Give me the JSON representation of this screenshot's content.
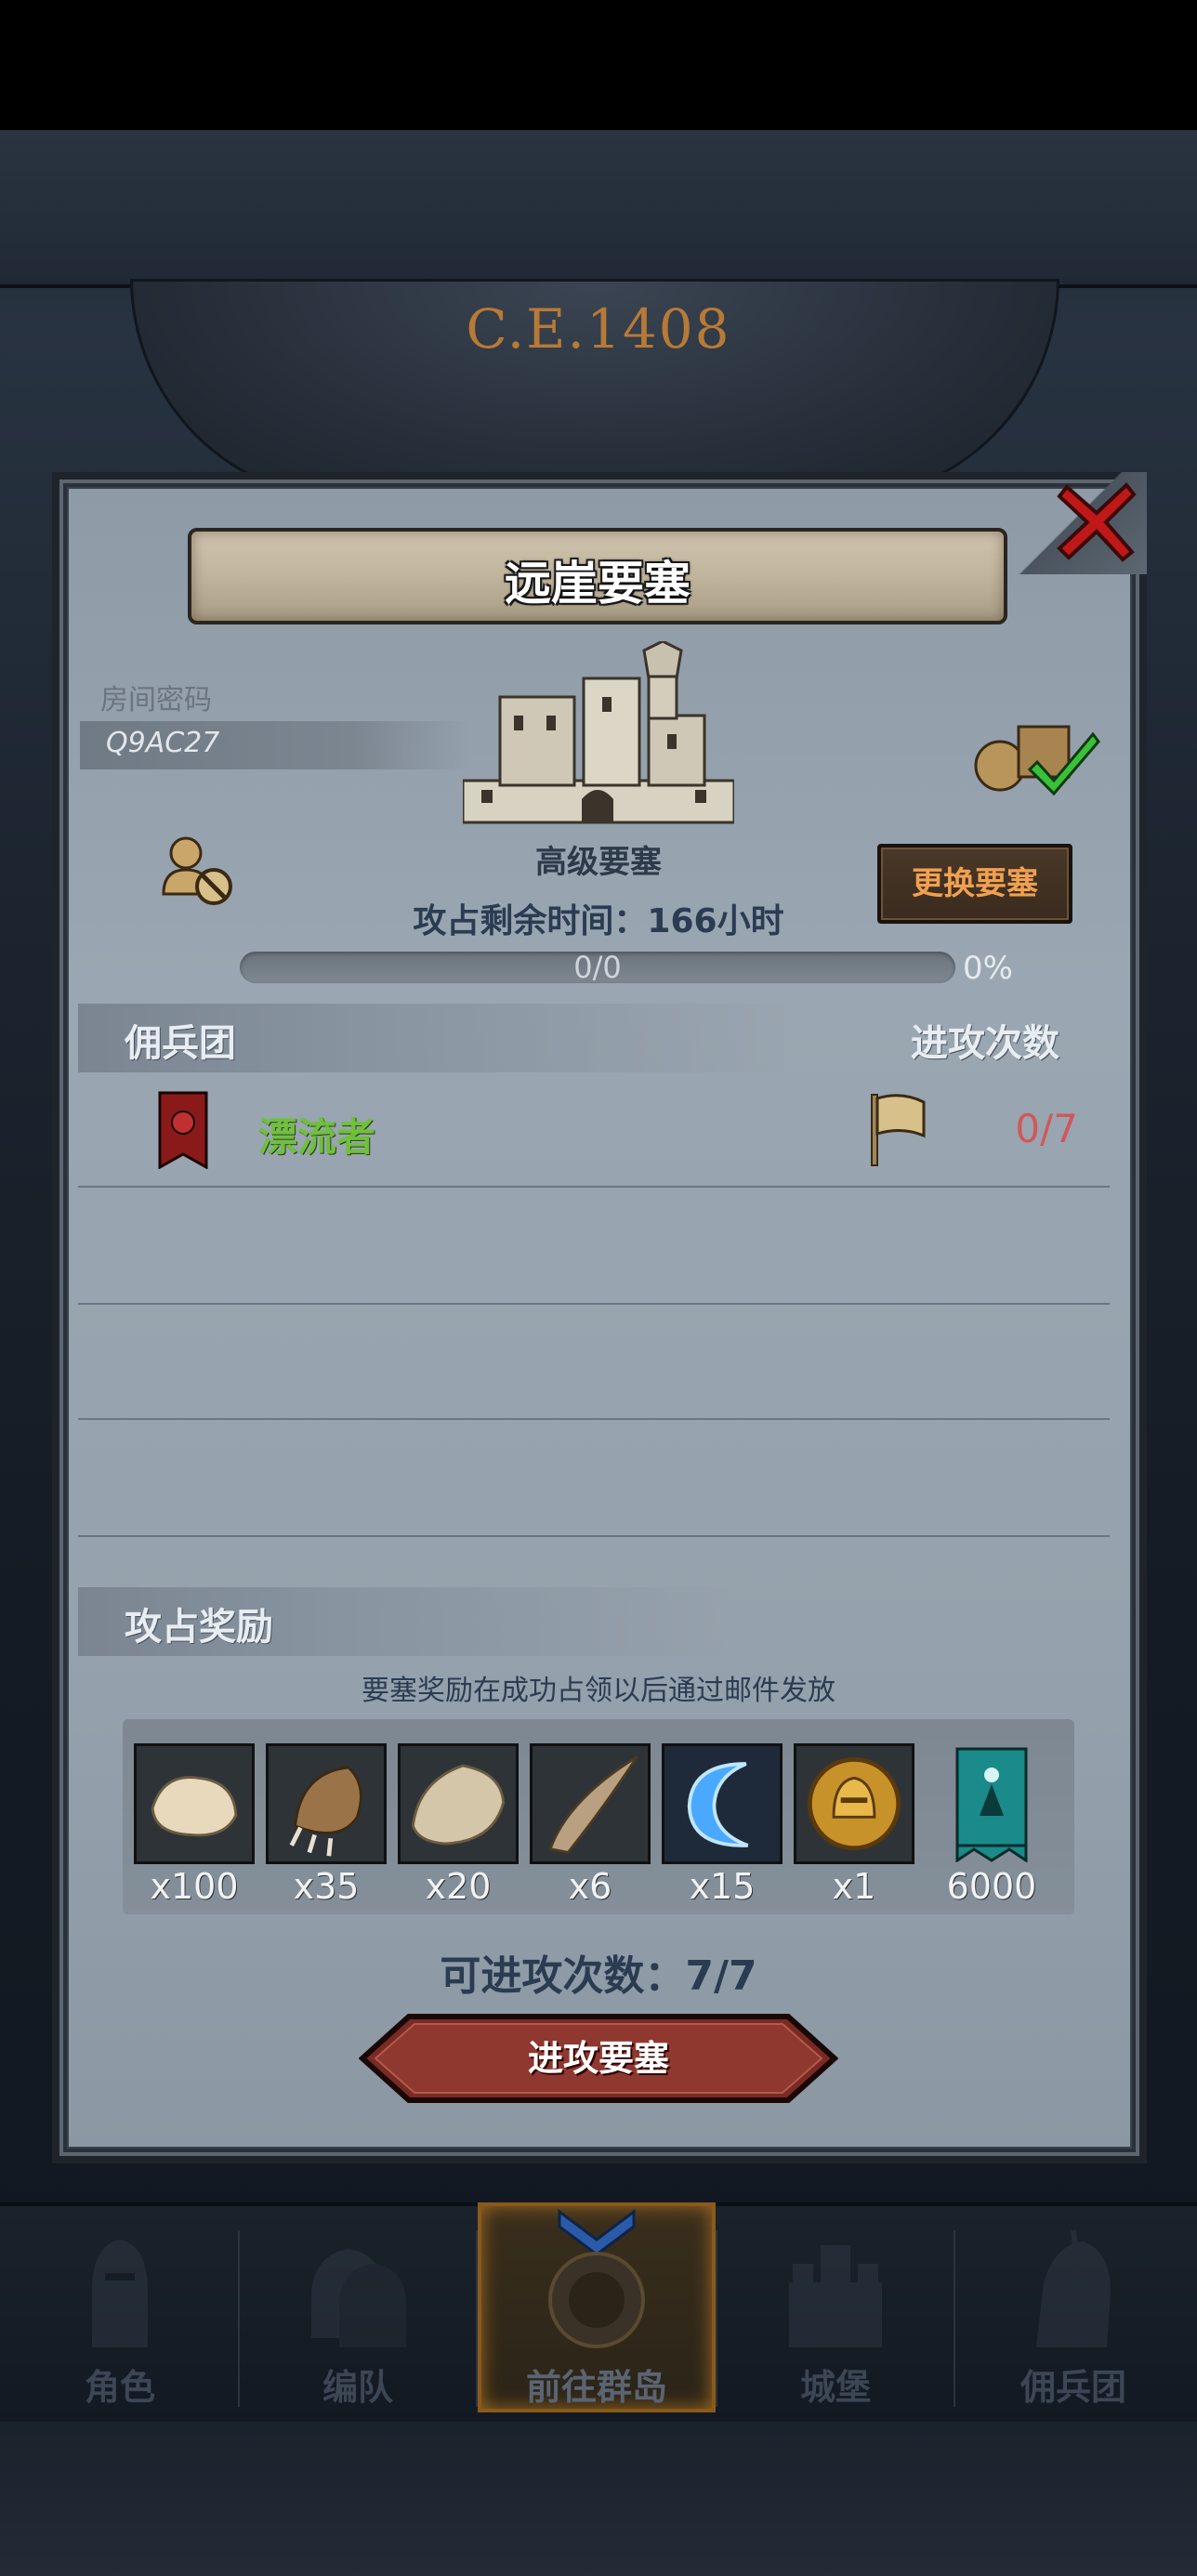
{
  "background": {
    "year_text": "C.E.1408"
  },
  "dialog": {
    "title": "远崖要塞",
    "room_label": "房间密码",
    "room_code": "Q9AC27",
    "fortress_label": "高级要塞",
    "swap_button": "更换要塞",
    "timer_text": "攻占剩余时间：166小时",
    "progress": {
      "text": "0/0",
      "percent_text": "0%",
      "fraction": 0
    },
    "mercenary_section": {
      "title": "佣兵团",
      "right_label": "进攻次数",
      "rows": [
        {
          "name": "漂流者",
          "count": "0/7"
        }
      ]
    },
    "reward_section": {
      "title": "攻占奖励",
      "note": "要塞奖励在成功占领以后通过邮件发放",
      "items": [
        {
          "icon": "fur-icon",
          "qty": "x100"
        },
        {
          "icon": "claw-icon",
          "qty": "x35"
        },
        {
          "icon": "pelt-icon",
          "qty": "x20"
        },
        {
          "icon": "horn-icon",
          "qty": "x6"
        },
        {
          "icon": "blue-crescent-icon",
          "qty": "x15"
        },
        {
          "icon": "gold-helmet-coin-icon",
          "qty": "x1"
        },
        {
          "icon": "teal-banner-icon",
          "qty": "6000"
        }
      ]
    },
    "attacks_left": "可进攻次数：7/7",
    "attack_button": "进攻要塞"
  },
  "nav": {
    "items": [
      {
        "label": "角色"
      },
      {
        "label": "编队"
      },
      {
        "label": "前往群岛"
      },
      {
        "label": "城堡"
      },
      {
        "label": "佣兵团"
      }
    ]
  },
  "colors": {
    "accent_orange": "#f0a050",
    "mercenary_green": "#6fc03a",
    "count_red": "#d05858",
    "close_red": "#c01818"
  }
}
